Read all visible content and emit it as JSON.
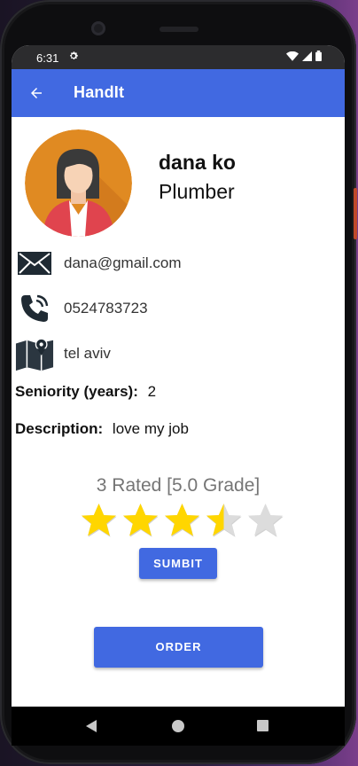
{
  "status_bar": {
    "time": "6:31",
    "icons": [
      "settings-icon",
      "wifi-icon",
      "signal-icon",
      "battery-icon"
    ]
  },
  "app_bar": {
    "title": "HandIt",
    "back_icon": "arrow-back-icon",
    "color": "#4169e1"
  },
  "profile": {
    "name": "dana ko",
    "role": "Plumber",
    "avatar_icon": "woman-avatar-icon"
  },
  "contact": {
    "email": "dana@gmail.com",
    "phone": "0524783723",
    "city": "tel aviv"
  },
  "details": {
    "seniority_label": "Seniority (years):",
    "seniority_value": "2",
    "description_label": "Description:",
    "description_value": "love my job"
  },
  "rating": {
    "text": "3 Rated [5.0 Grade]",
    "stars_filled": 3.5,
    "stars_total": 5,
    "star_color": "#ffd600",
    "empty_star_color": "#dcdcdc"
  },
  "buttons": {
    "submit_label": "SUMBIT",
    "order_label": "ORDER"
  }
}
